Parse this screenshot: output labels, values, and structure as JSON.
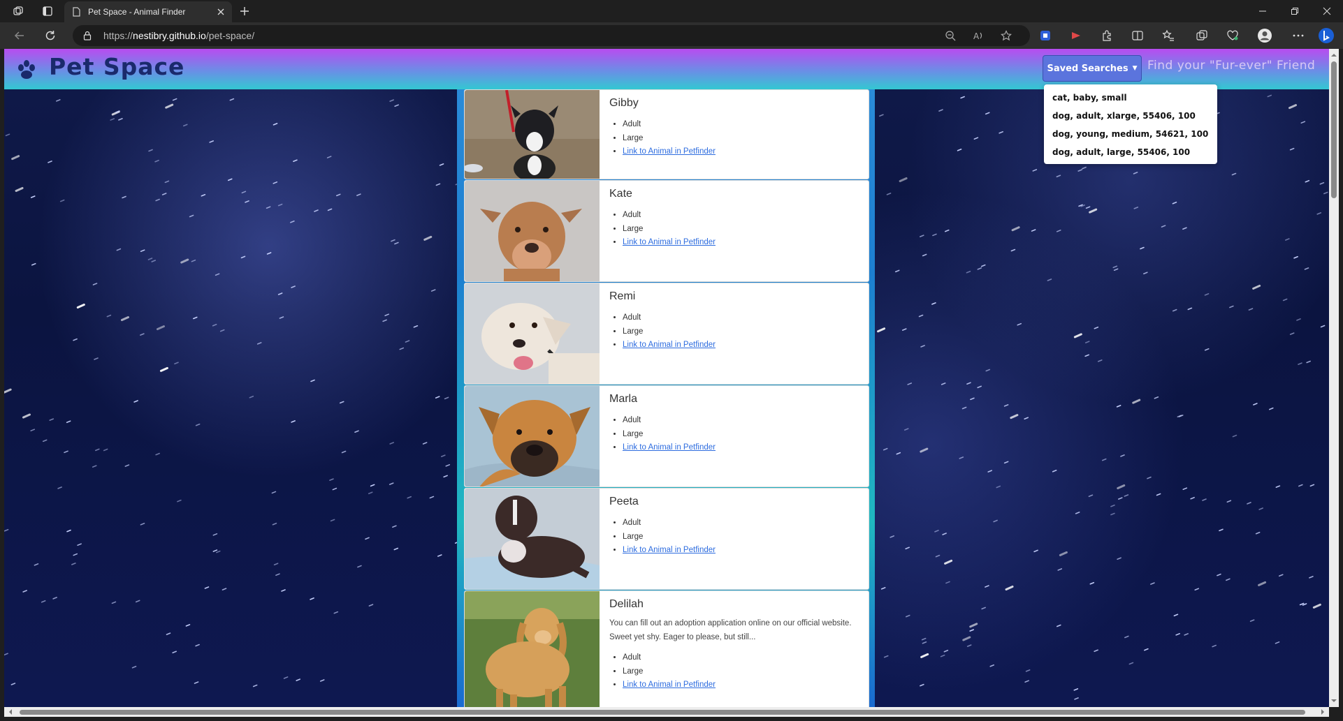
{
  "browser": {
    "tab_title": "Pet Space - Animal Finder",
    "url_scheme": "https://",
    "url_host": "nestibry.github.io",
    "url_path": "/pet-space/"
  },
  "navbar": {
    "brand": "Pet Space",
    "saved_searches_label": "Saved Searches",
    "tagline": "Find your \"Fur-ever\" Friend",
    "saved_searches": [
      "cat, baby, small",
      "dog, adult, xlarge, 55406, 100",
      "dog, young, medium, 54621, 100",
      "dog, adult, large, 55406, 100"
    ]
  },
  "pets": [
    {
      "name": "Gibby",
      "age": "Adult",
      "size": "Large",
      "link": "Link to Animal in Petfinder"
    },
    {
      "name": "Kate",
      "age": "Adult",
      "size": "Large",
      "link": "Link to Animal in Petfinder"
    },
    {
      "name": "Remi",
      "age": "Adult",
      "size": "Large",
      "link": "Link to Animal in Petfinder"
    },
    {
      "name": "Marla",
      "age": "Adult",
      "size": "Large",
      "link": "Link to Animal in Petfinder"
    },
    {
      "name": "Peeta",
      "age": "Adult",
      "size": "Large",
      "link": "Link to Animal in Petfinder"
    },
    {
      "name": "Delilah",
      "description": "You can fill out an adoption application online on our official website. Sweet yet shy. Eager to please, but still...",
      "age": "Adult",
      "size": "Large",
      "link": "Link to Animal in Petfinder"
    }
  ],
  "colors": {
    "navbar_gradient_top": "#b84cf0",
    "navbar_gradient_bottom": "#33c8d2",
    "brand_text": "#1a2a6c",
    "saved_button": "#5b74dd",
    "link": "#2d6cdf",
    "space_background": "#0b1440"
  }
}
